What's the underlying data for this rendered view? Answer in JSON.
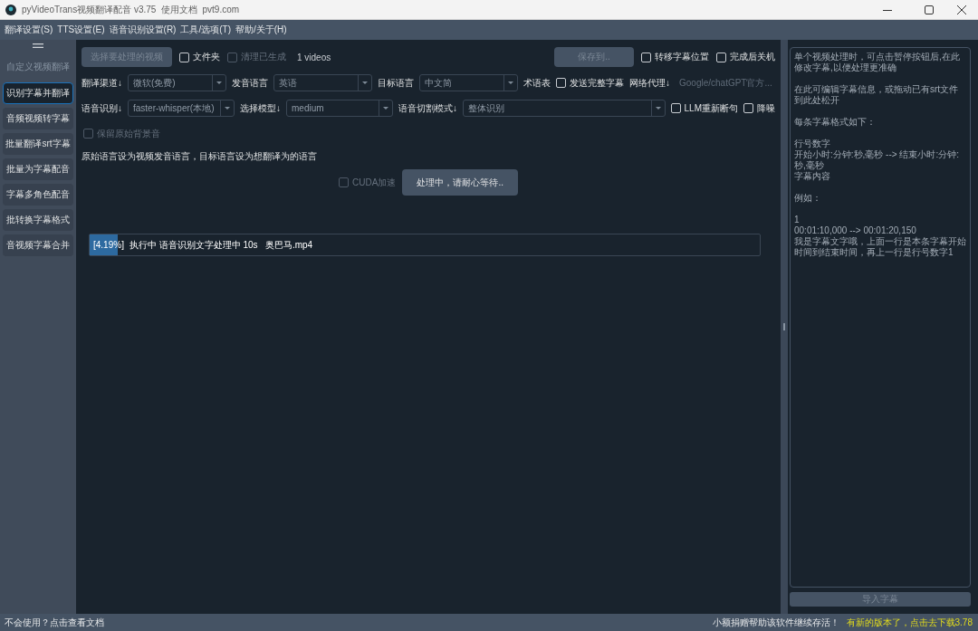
{
  "window": {
    "title": "pyVideoTrans视频翻译配音 v3.75  使用文档  pvt9.com"
  },
  "menu": [
    "翻译设置(S)",
    "TTS设置(E)",
    "语音识别设置(R)",
    "工具/选项(T)",
    "帮助/关于(H)"
  ],
  "sidebar": {
    "heading": "自定义视频翻译",
    "items": [
      {
        "label": "识别字幕并翻译",
        "selected": true
      },
      {
        "label": "音频视频转字幕",
        "selected": false
      },
      {
        "label": "批量翻译srt字幕",
        "selected": false
      },
      {
        "label": "批量为字幕配音",
        "selected": false
      },
      {
        "label": "字幕多角色配音",
        "selected": false
      },
      {
        "label": "批转换字幕格式",
        "selected": false
      },
      {
        "label": "音视频字幕合并",
        "selected": false
      }
    ]
  },
  "file_bar": {
    "left": [
      {
        "kind": "button",
        "label": "选择要处理的视频",
        "disabled": true
      },
      {
        "kind": "checkbox",
        "label": "文件夹",
        "checked": false,
        "disabled": false
      },
      {
        "kind": "checkbox",
        "label": "清理已生成",
        "checked": false,
        "disabled": true
      },
      {
        "kind": "text",
        "label": "1 videos"
      }
    ],
    "right": [
      {
        "kind": "button",
        "label": "保存到..",
        "disabled": true
      },
      {
        "kind": "checkbox",
        "label": "转移字幕位置",
        "checked": false,
        "disabled": false
      },
      {
        "kind": "checkbox",
        "label": "完成后关机",
        "checked": false,
        "disabled": false
      }
    ]
  },
  "settings_rows": [
    {
      "items": [
        {
          "kind": "label",
          "label": "翻译渠道↓"
        },
        {
          "kind": "combo",
          "value": "微软(免费)"
        },
        {
          "kind": "label",
          "label": "发音语言"
        },
        {
          "kind": "combo",
          "value": "英语"
        },
        {
          "kind": "label",
          "label": "目标语言"
        },
        {
          "kind": "combo",
          "value": "中文简"
        },
        {
          "kind": "label",
          "label": "术语表"
        },
        {
          "kind": "checkbox",
          "label": "发送完整字幕",
          "checked": false,
          "disabled": false
        },
        {
          "kind": "label",
          "label": "网络代理↓"
        },
        {
          "kind": "field",
          "placeholder": "Google/chatGPT官方..."
        }
      ]
    },
    {
      "items": [
        {
          "kind": "label",
          "label": "语音识别↓"
        },
        {
          "kind": "combo",
          "value": "faster-whisper(本地)"
        },
        {
          "kind": "label",
          "label": "选择模型↓"
        },
        {
          "kind": "combo",
          "value": "medium"
        },
        {
          "kind": "label",
          "label": "语音切割模式↓"
        },
        {
          "kind": "combo",
          "value": "整体识别"
        },
        {
          "kind": "checkbox",
          "label": "LLM重新断句",
          "checked": false,
          "disabled": false
        },
        {
          "kind": "checkbox",
          "label": "降噪",
          "checked": false,
          "disabled": false
        }
      ]
    },
    {
      "items": [
        {
          "kind": "checkbox",
          "label": "保留原始背景音",
          "checked": false,
          "disabled": true
        }
      ]
    }
  ],
  "hint": "原始语言设为视频发音语言，目标语言设为想翻译为的语言",
  "run_bar": [
    {
      "kind": "checkbox",
      "label": "CUDA加速",
      "checked": false,
      "disabled": true
    },
    {
      "kind": "button",
      "label": "处理中，请耐心等待..",
      "disabled": false
    }
  ],
  "progress": {
    "percent": "[4.19%]",
    "level": 0.0419,
    "message": "执行中 语音识别文字处理中 10s   奥巴马.mp4"
  },
  "subtitle_editor": {
    "placeholder_paragraphs": [
      {
        "lines": [
          "单个视频处理时，可点击暂停按钮后,在此修改字幕,以便处理更准确"
        ]
      },
      {
        "lines": [
          "在此可编辑字幕信息，或拖动已有srt文件到此处松开"
        ]
      },
      {
        "lines": [
          "每条字幕格式如下："
        ]
      },
      {
        "lines": [
          "行号数字",
          "开始小时:分钟:秒,毫秒 --> 结束小时:分钟:秒,毫秒",
          "字幕内容"
        ]
      },
      {
        "lines": [
          "例如："
        ]
      },
      {
        "lines": [
          "1",
          "00:01:10,000 --> 00:01:20,150",
          "我是字幕文字哦，上面一行是本条字幕开始时间到结束时间，再上一行是行号数字1"
        ]
      }
    ]
  },
  "import_button": {
    "label": "导入字幕",
    "disabled": true
  },
  "status_bar": {
    "help_link": "不会使用？点击查看文档",
    "donate": "小额捐赠帮助该软件继续存活！",
    "update_link": "有新的版本了，点击去下载3.78"
  }
}
